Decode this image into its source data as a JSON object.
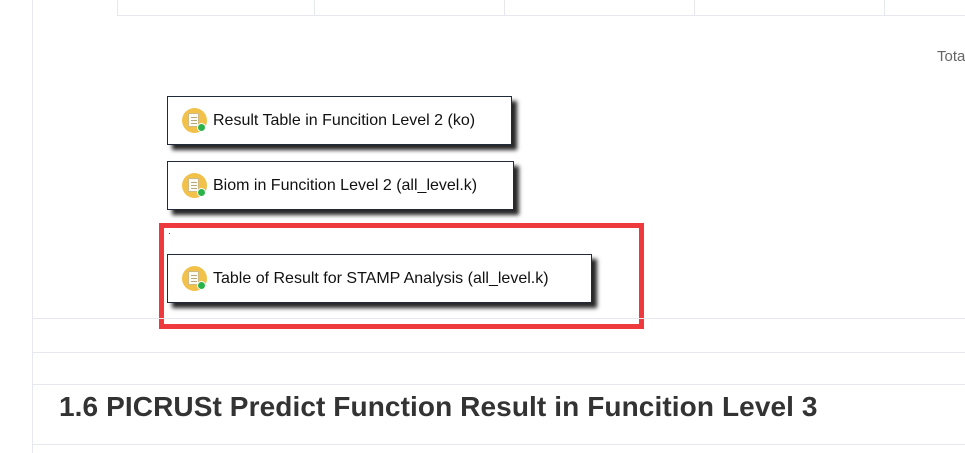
{
  "table": {
    "total_label": "Tota"
  },
  "downloads": [
    {
      "label": "Result Table in Funcition Level 2 (ko)",
      "icon": "file-download-icon"
    },
    {
      "label": "Biom in Funcition Level 2 (all_level.k)",
      "icon": "file-download-icon"
    },
    {
      "label": "Table of Result for STAMP Analysis (all_level.k)",
      "icon": "file-download-icon"
    }
  ],
  "section": {
    "heading": "1.6 PICRUSt Predict Function Result in Funcition Level 3"
  },
  "colors": {
    "highlight": "#ee3a3d",
    "icon_bg": "#f2c14a",
    "badge": "#2bb34a",
    "border": "#1f2a3a"
  }
}
